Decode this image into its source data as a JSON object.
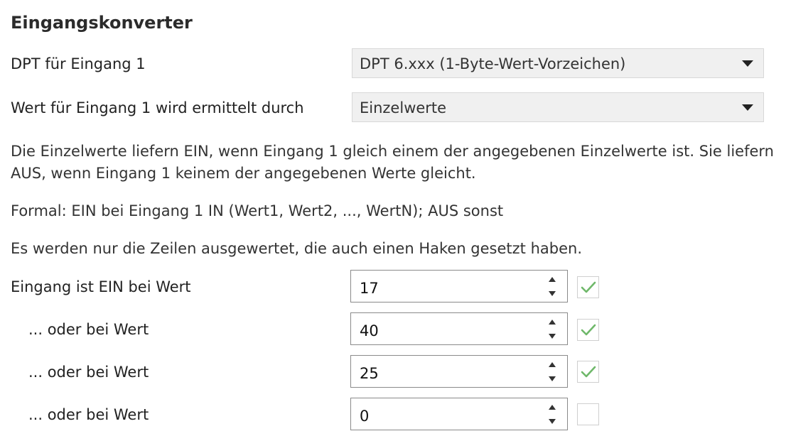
{
  "section": {
    "title": "Eingangskonverter"
  },
  "dpt": {
    "label": "DPT für Eingang 1",
    "value": "DPT 6.xxx (1-Byte-Wert-Vorzeichen)"
  },
  "method": {
    "label": "Wert für Eingang 1 wird ermittelt durch",
    "value": "Einzelwerte"
  },
  "info": {
    "description": "Die Einzelwerte liefern EIN, wenn Eingang 1 gleich einem der angegebenen Einzelwerte ist. Sie liefern AUS, wenn Eingang 1 keinem der angegebenen Werte gleicht.",
    "formula": "Formal: EIN bei Eingang 1 IN (Wert1, Wert2, ..., WertN); AUS sonst",
    "note": "Es werden nur die Zeilen ausgewertet, die auch einen Haken gesetzt haben."
  },
  "values": [
    {
      "label": "Eingang ist EIN bei Wert",
      "value": "17",
      "checked": true
    },
    {
      "label": "... oder bei Wert",
      "value": "40",
      "checked": true
    },
    {
      "label": "... oder bei Wert",
      "value": "25",
      "checked": true
    },
    {
      "label": "... oder bei Wert",
      "value": "0",
      "checked": false
    }
  ],
  "colors": {
    "checkmark": "#6fb86a"
  },
  "icons": {
    "dropdown": "chevron-down-icon",
    "spin_up": "caret-up-icon",
    "spin_down": "caret-down-icon",
    "check": "checkmark-icon"
  }
}
